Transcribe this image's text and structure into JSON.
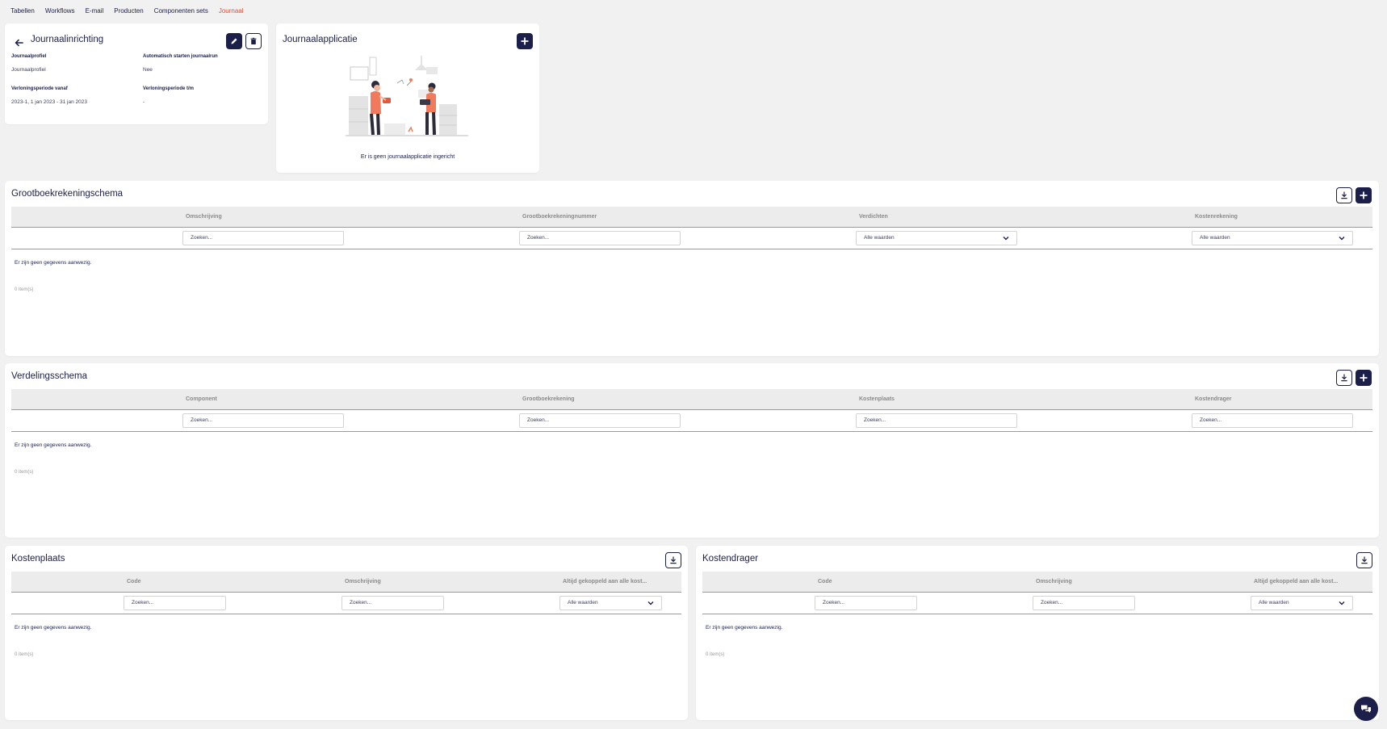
{
  "nav": {
    "items": [
      "Tabellen",
      "Workflows",
      "E-mail",
      "Producten",
      "Componenten sets",
      "Journaal"
    ],
    "active": "Journaal",
    "active_color": "#e0503a"
  },
  "setup": {
    "title": "Journaalinrichting",
    "fields": [
      {
        "label": "Journaalprofiel",
        "value": "Journaalprofiel"
      },
      {
        "label": "Automatisch starten journaalrun",
        "value": "Nee"
      },
      {
        "label": "Verloningsperiode vanaf",
        "value": "2023-1, 1 jan 2023 - 31 jan 2023"
      },
      {
        "label": "Verloningsperiode t/m",
        "value": "-"
      }
    ]
  },
  "application": {
    "title": "Journaalapplicatie",
    "empty_text": "Er is geen journaalapplicatie ingericht"
  },
  "tables": {
    "ledger": {
      "title": "Grootboekrekeningschema",
      "columns": [
        "Omschrijving",
        "Grootboekrekeningnummer",
        "Verdichten",
        "Kostenrekening"
      ],
      "filters": [
        "Zoeken...",
        "Zoeken...",
        "Alle waarden",
        "Alle waarden"
      ],
      "empty": "Er zijn geen gegevens aanwezig.",
      "count": "0 item(s)"
    },
    "distribution": {
      "title": "Verdelingsschema",
      "columns": [
        "Component",
        "Grootboekrekening",
        "Kostenplaats",
        "Kostendrager"
      ],
      "filters": [
        "Zoeken...",
        "Zoeken...",
        "Zoeken...",
        "Zoeken..."
      ],
      "empty": "Er zijn geen gegevens aanwezig.",
      "count": "0 item(s)"
    },
    "costcenter": {
      "title": "Kostenplaats",
      "columns": [
        "Code",
        "Omschrijving",
        "Altijd gekoppeld aan alle kost..."
      ],
      "filters": [
        "Zoeken...",
        "Zoeken...",
        "Alle waarden"
      ],
      "empty": "Er zijn geen gegevens aanwezig.",
      "count": "0 item(s)"
    },
    "costcarrier": {
      "title": "Kostendrager",
      "columns": [
        "Code",
        "Omschrijving",
        "Altijd gekoppeld aan alle kost..."
      ],
      "filters": [
        "Zoeken...",
        "Zoeken...",
        "Alle waarden"
      ],
      "empty": "Er zijn geen gegevens aanwezig.",
      "count": "0 item(s)"
    }
  },
  "colors": {
    "primary": "#1b1f4a",
    "accent": "#e0503a",
    "background": "#f1f1f1"
  }
}
